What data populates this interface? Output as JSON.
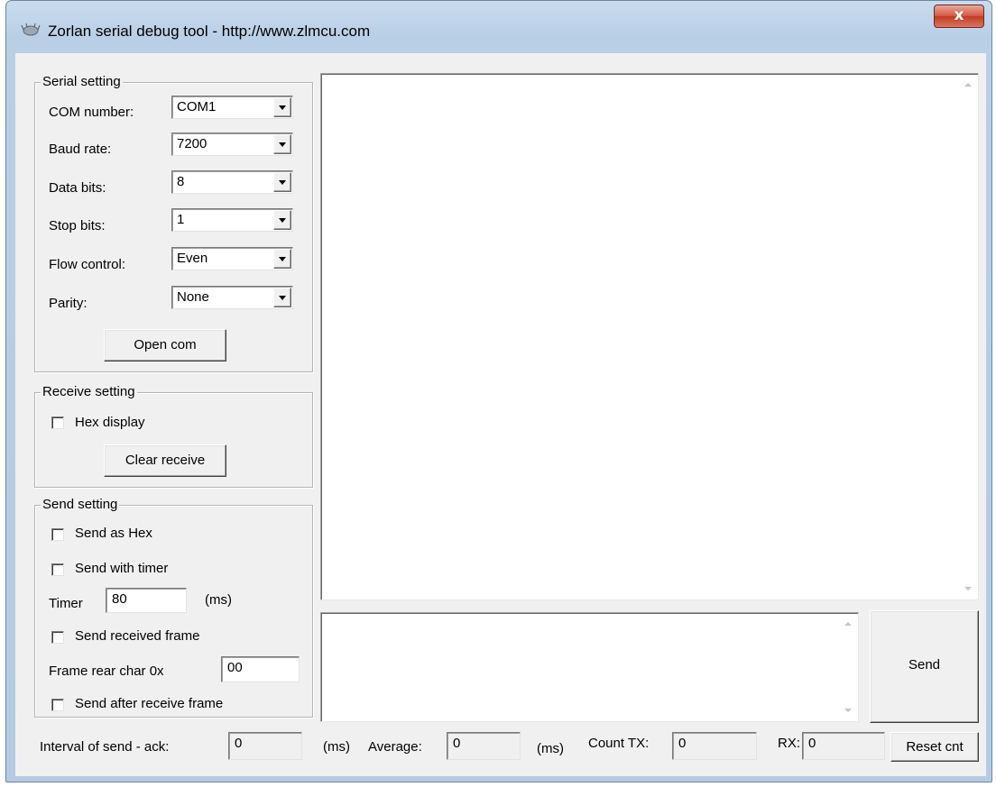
{
  "window": {
    "title": "Zorlan serial debug tool - http://www.zlmcu.com",
    "close_glyph": "x",
    "icon": "app-icon"
  },
  "serial_setting": {
    "legend": "Serial setting",
    "com_number": {
      "label": "COM number:",
      "value": "COM1"
    },
    "baud_rate": {
      "label": "Baud rate:",
      "value": "7200"
    },
    "data_bits": {
      "label": "Data bits:",
      "value": "8"
    },
    "stop_bits": {
      "label": "Stop bits:",
      "value": "1"
    },
    "flow_control": {
      "label": "Flow control:",
      "value": "Even"
    },
    "parity": {
      "label": "Parity:",
      "value": "None"
    },
    "open_button": "Open com"
  },
  "receive_setting": {
    "legend": "Receive setting",
    "hex_display": {
      "label": "Hex display",
      "checked": false
    },
    "clear_button": "Clear receive"
  },
  "send_setting": {
    "legend": "Send setting",
    "send_as_hex": {
      "label": "Send as Hex",
      "checked": false
    },
    "send_with_timer": {
      "label": "Send with timer",
      "checked": false
    },
    "timer": {
      "label": "Timer",
      "value": "80",
      "unit": "(ms)"
    },
    "send_received_frame": {
      "label": "Send received frame",
      "checked": false
    },
    "frame_rear_char": {
      "label": "Frame rear char 0x",
      "value": "00"
    },
    "send_after_receive_frame": {
      "label": "Send after receive frame",
      "checked": false
    }
  },
  "receive_area": {
    "text": ""
  },
  "send_area": {
    "text": ""
  },
  "send_button": "Send",
  "status_bar": {
    "interval_label": "Interval of send - ack:",
    "interval_value": "0",
    "interval_unit": "(ms)",
    "average_label": "Average:",
    "average_value": "0",
    "average_unit": "(ms)",
    "count_tx_label": "Count TX:",
    "count_tx_value": "0",
    "rx_label": "RX:",
    "rx_value": "0",
    "reset_button": "Reset cnt"
  },
  "colors": {
    "frame": "#b9cfe6",
    "client": "#f0f0f0",
    "close_button": "#c43b22"
  }
}
